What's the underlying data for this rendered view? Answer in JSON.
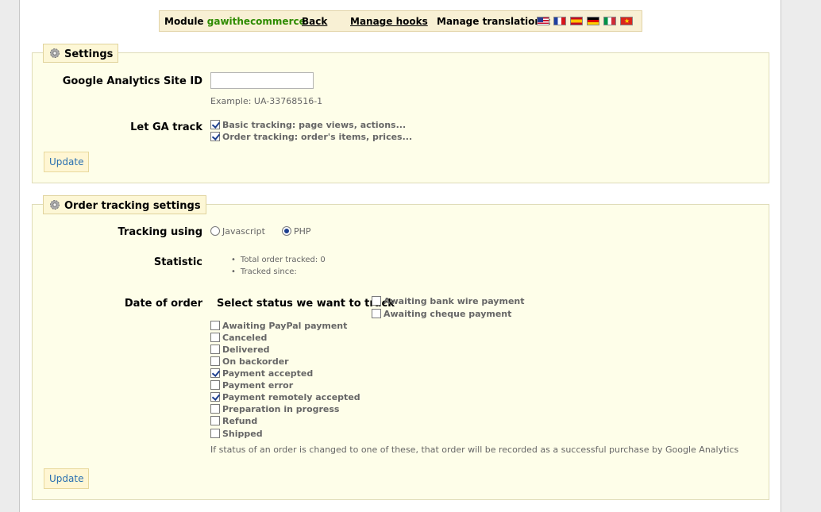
{
  "toolbar": {
    "module_label": "Module",
    "module_name": "gawithecommerce",
    "back": "Back",
    "manage_hooks": "Manage hooks",
    "manage_translations": "Manage translations:",
    "flags": [
      "en",
      "fr",
      "es",
      "de",
      "it",
      "vn"
    ]
  },
  "settings": {
    "legend": "Settings",
    "site_id_label": "Google Analytics Site ID",
    "site_id_value": "",
    "site_id_example": "Example: UA-33768516-1",
    "track_label": "Let GA track",
    "track_options": [
      {
        "label": "Basic tracking: page views, actions...",
        "checked": true
      },
      {
        "label": "Order tracking: order's items, prices...",
        "checked": true
      }
    ],
    "update": "Update"
  },
  "order_tracking": {
    "legend": "Order tracking settings",
    "tracking_using_label": "Tracking using",
    "tracking_options": [
      {
        "label": "Javascript",
        "selected": false
      },
      {
        "label": "PHP",
        "selected": true
      }
    ],
    "statistic_label": "Statistic",
    "statistics": [
      "Total order tracked: 0",
      "Tracked since:"
    ],
    "date_of_order_label": "Date of order",
    "select_status_label": "Select status we want to track",
    "statuses": [
      {
        "label": "Awaiting bank wire payment",
        "checked": false
      },
      {
        "label": "Awaiting cheque payment",
        "checked": false
      },
      {
        "label": "Awaiting PayPal payment",
        "checked": false
      },
      {
        "label": "Canceled",
        "checked": false
      },
      {
        "label": "Delivered",
        "checked": false
      },
      {
        "label": "On backorder",
        "checked": false
      },
      {
        "label": "Payment accepted",
        "checked": true
      },
      {
        "label": "Payment error",
        "checked": false
      },
      {
        "label": "Payment remotely accepted",
        "checked": true
      },
      {
        "label": "Preparation in progress",
        "checked": false
      },
      {
        "label": "Refund",
        "checked": false
      },
      {
        "label": "Shipped",
        "checked": false
      }
    ],
    "note": "If status of an order is changed to one of these, that order will be recorded as a successful purchase by Google Analytics",
    "update": "Update"
  }
}
